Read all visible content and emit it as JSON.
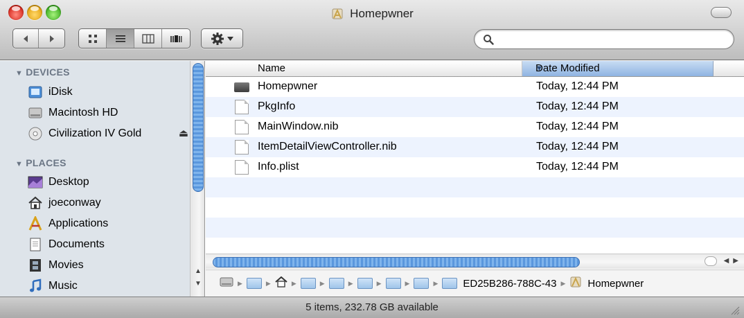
{
  "window": {
    "title": "Homepwner"
  },
  "search": {
    "value": "",
    "placeholder": ""
  },
  "sidebar": {
    "devices_header": "DEVICES",
    "places_header": "PLACES",
    "devices": [
      {
        "label": "iDisk",
        "icon": "idisk-icon"
      },
      {
        "label": "Macintosh HD",
        "icon": "hard-drive-icon"
      },
      {
        "label": "Civilization IV Gold",
        "icon": "cd-icon",
        "ejectable": true
      }
    ],
    "places": [
      {
        "label": "Desktop",
        "icon": "desktop-icon"
      },
      {
        "label": "joeconway",
        "icon": "home-icon"
      },
      {
        "label": "Applications",
        "icon": "applications-icon"
      },
      {
        "label": "Documents",
        "icon": "documents-icon"
      },
      {
        "label": "Movies",
        "icon": "movies-icon"
      },
      {
        "label": "Music",
        "icon": "music-icon"
      }
    ]
  },
  "columns": {
    "name": "Name",
    "date": "Date Modified"
  },
  "files": [
    {
      "name": "Homepwner",
      "date": "Today, 12:44 PM",
      "icon": "executable-icon"
    },
    {
      "name": "PkgInfo",
      "date": "Today, 12:44 PM",
      "icon": "document-icon"
    },
    {
      "name": "MainWindow.nib",
      "date": "Today, 12:44 PM",
      "icon": "document-icon"
    },
    {
      "name": "ItemDetailViewController.nib",
      "date": "Today, 12:44 PM",
      "icon": "document-icon"
    },
    {
      "name": "Info.plist",
      "date": "Today, 12:44 PM",
      "icon": "document-icon"
    }
  ],
  "pathbar": {
    "folder_label": "ED25B286-788C-43",
    "app_label": "Homepwner"
  },
  "status": {
    "text": "5 items, 232.78 GB available"
  },
  "colors": {
    "sidebar_bg": "#dee4ea",
    "selection_blue": "#8fb4e2",
    "alt_row": "#edf3fe"
  }
}
